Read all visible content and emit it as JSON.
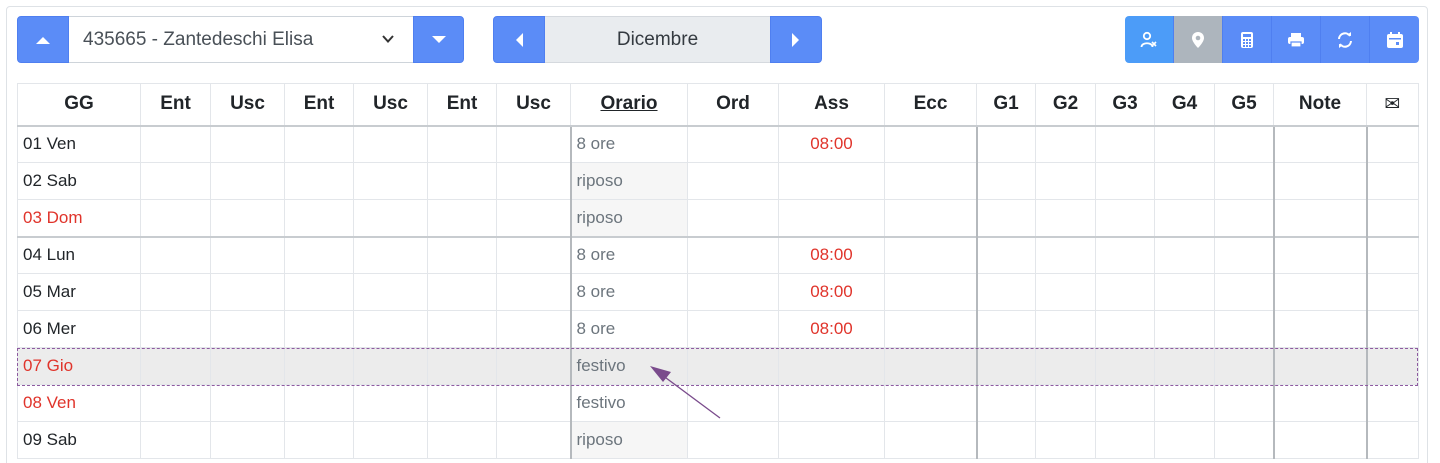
{
  "employee": {
    "selected": "435665 - Zantedeschi Elisa"
  },
  "month": {
    "label": "Dicembre"
  },
  "tools": [
    {
      "name": "user-badge-icon",
      "title": "Utente"
    },
    {
      "name": "location-pin-icon",
      "title": "Posizione"
    },
    {
      "name": "calculator-icon",
      "title": "Calcolatrice"
    },
    {
      "name": "printer-icon",
      "title": "Stampa"
    },
    {
      "name": "refresh-icon",
      "title": "Aggiorna"
    },
    {
      "name": "calendar-icon",
      "title": "Calendario"
    }
  ],
  "columns": [
    "GG",
    "Ent",
    "Usc",
    "Ent",
    "Usc",
    "Ent",
    "Usc",
    "Orario",
    "Ord",
    "Ass",
    "Ecc",
    "G1",
    "G2",
    "G3",
    "G4",
    "G5",
    "Note",
    "✉"
  ],
  "rows": [
    {
      "gg": "01 Ven",
      "orario": "8 ore",
      "ass": "08:00",
      "holiday": false,
      "rest": false
    },
    {
      "gg": "02 Sab",
      "orario": "riposo",
      "ass": "",
      "holiday": false,
      "rest": true
    },
    {
      "gg": "03 Dom",
      "orario": "riposo",
      "ass": "",
      "holiday": true,
      "rest": true
    },
    {
      "gg": "04 Lun",
      "orario": "8 ore",
      "ass": "08:00",
      "holiday": false,
      "rest": false
    },
    {
      "gg": "05 Mar",
      "orario": "8 ore",
      "ass": "08:00",
      "holiday": false,
      "rest": false
    },
    {
      "gg": "06 Mer",
      "orario": "8 ore",
      "ass": "08:00",
      "holiday": false,
      "rest": false
    },
    {
      "gg": "07 Gio",
      "orario": "festivo",
      "ass": "",
      "holiday": true,
      "rest": false
    },
    {
      "gg": "08 Ven",
      "orario": "festivo",
      "ass": "",
      "holiday": true,
      "rest": false
    },
    {
      "gg": "09 Sab",
      "orario": "riposo",
      "ass": "",
      "holiday": false,
      "rest": true
    }
  ],
  "colors": {
    "accent": "#5b8cf7",
    "holiday_text": "#e0342b",
    "highlight_border": "#8e5aa0"
  }
}
